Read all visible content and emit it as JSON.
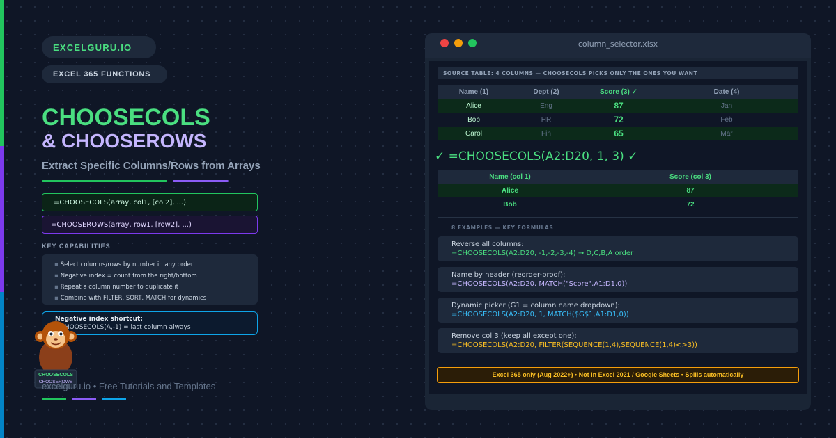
{
  "brand": "EXCELGURU.IO",
  "tag": "EXCEL 365 FUNCTIONS",
  "title_line1": "CHOOSECOLS",
  "title_line2": "& CHOOSEROWS",
  "subtitle": "Extract Specific Columns/Rows from Arrays",
  "syntax": {
    "choosecols": "=CHOOSECOLS(array, col1, [col2], ...)",
    "chooserows": "=CHOOSEROWS(array, row1, [row2], ...)"
  },
  "capabilities": {
    "heading": "KEY CAPABILITIES",
    "items": [
      "Select columns/rows by number in any order",
      "Negative index = count from the right/bottom",
      "Repeat a column number to duplicate it",
      "Combine with FILTER, SORT, MATCH for dynamics"
    ]
  },
  "negative_tip": {
    "title": "Negative index shortcut:",
    "text": "=CHOOSECOLS(A,-1) = last column always"
  },
  "mascot": {
    "line1": "CHOOSECOLS",
    "line2": "CHOOSEROWS"
  },
  "footer": "excelguru.io • Free Tutorials and Templates",
  "colors": {
    "green": "#4ade80",
    "purple": "#8b5cf6",
    "blue": "#0ea5e9",
    "amber": "#fbbf24"
  },
  "window": {
    "filename": "column_selector.xlsx",
    "source_label": "SOURCE TABLE: 4 COLUMNS — CHOOSECOLS PICKS ONLY THE ONES YOU WANT",
    "source_headers": [
      "Name (1)",
      "Dept (2)",
      "Score (3) ✓",
      "Date (4)"
    ],
    "source_rows": [
      [
        "Alice",
        "Eng",
        "87",
        "Jan"
      ],
      [
        "Bob",
        "HR",
        "72",
        "Feb"
      ],
      [
        "Carol",
        "Fin",
        "65",
        "Mar"
      ]
    ],
    "formula": "✓ =CHOOSECOLS(A2:D20, 1, 3) ✓",
    "result_headers": [
      "Name (col 1)",
      "Score (col 3)"
    ],
    "result_rows": [
      [
        "Alice",
        "87"
      ],
      [
        "Bob",
        "72"
      ]
    ],
    "examples_heading": "8 EXAMPLES — KEY FORMULAS",
    "examples": [
      {
        "desc": "Reverse all columns:",
        "formula": "=CHOOSECOLS(A2:D20, -1,-2,-3,-4) → D,C,B,A order",
        "color": "#4ade80"
      },
      {
        "desc": "Name by header (reorder-proof):",
        "formula": "=CHOOSECOLS(A2:D20, MATCH(\"Score\",A1:D1,0))",
        "color": "#c4b5fd"
      },
      {
        "desc": "Dynamic picker (G1 = column name dropdown):",
        "formula": "=CHOOSECOLS(A2:D20, 1, MATCH($G$1,A1:D1,0))",
        "color": "#38bdf8"
      },
      {
        "desc": "Remove col 3 (keep all except one):",
        "formula": "=CHOOSECOLS(A2:D20, FILTER(SEQUENCE(1,4),SEQUENCE(1,4)<>3))",
        "color": "#fbbf24"
      }
    ],
    "warning": "Excel 365 only (Aug 2022+) • Not in Excel 2021 / Google Sheets • Spills automatically"
  }
}
